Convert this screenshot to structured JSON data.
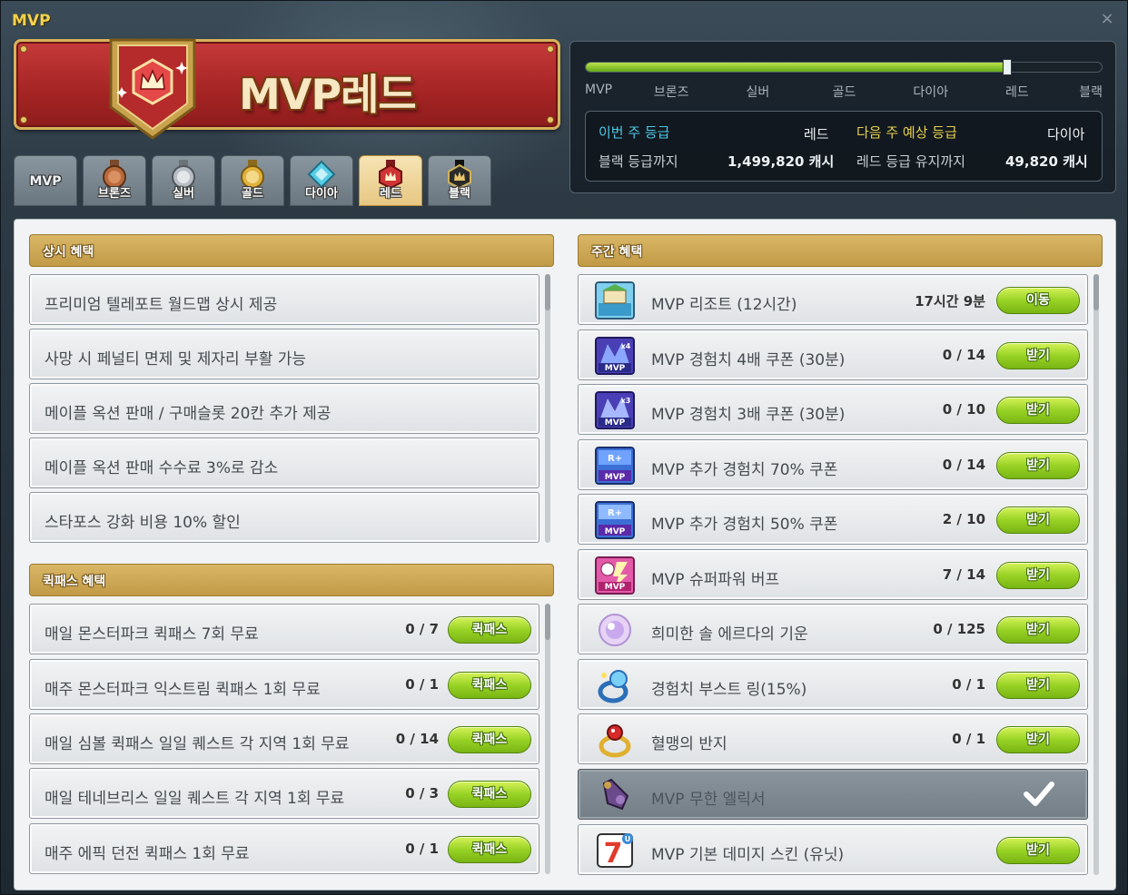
{
  "window": {
    "title": "MVP",
    "close_icon": "×"
  },
  "banner": {
    "text": "MVP레드",
    "medal_icon": "crown-medal-icon"
  },
  "tabs": [
    {
      "label": "MVP",
      "icon": "none",
      "active": false
    },
    {
      "label": "브론즈",
      "icon": "bronze-medal-icon",
      "active": false,
      "color": "#b86a3b"
    },
    {
      "label": "실버",
      "icon": "silver-medal-icon",
      "active": false,
      "color": "#b8bec4"
    },
    {
      "label": "골드",
      "icon": "gold-medal-icon",
      "active": false,
      "color": "#e0b23e"
    },
    {
      "label": "다이아",
      "icon": "diamond-medal-icon",
      "active": false,
      "color": "#57cde6"
    },
    {
      "label": "레드",
      "icon": "red-medal-icon",
      "active": true,
      "color": "#d03434"
    },
    {
      "label": "블랙",
      "icon": "black-medal-icon",
      "active": false,
      "color": "#2a2a2a"
    }
  ],
  "grade_progress": {
    "fill_fraction": 0.815,
    "labels": [
      "MVP",
      "브론즈",
      "실버",
      "골드",
      "다이아",
      "레드",
      "블랙"
    ]
  },
  "grade_info": {
    "this_week_label": "이번 주 등급",
    "this_week_value": "레드",
    "next_week_label": "다음 주 예상 등급",
    "next_week_value": "다이아",
    "to_black_label": "블랙 등급까지",
    "to_black_value": "1,499,820 캐시",
    "keep_red_label": "레드 등급 유지까지",
    "keep_red_value": "49,820 캐시"
  },
  "permanent": {
    "header": "상시 혜택",
    "items": [
      "프리미엄 텔레포트 월드맵 상시 제공",
      "사망 시 페널티 면제 및 제자리 부활 가능",
      "메이플 옥션 판매 / 구매슬롯 20칸 추가 제공",
      "메이플 옥션 판매 수수료 3%로 감소",
      "스타포스 강화 비용 10% 할인"
    ]
  },
  "quickpass": {
    "header": "퀵패스 혜택",
    "button_label": "퀵패스",
    "items": [
      {
        "label": "매일 몬스터파크 퀵패스 7회 무료",
        "count": "0 / 7"
      },
      {
        "label": "매주 몬스터파크 익스트림 퀵패스 1회 무료",
        "count": "0 / 1"
      },
      {
        "label": "매일 심볼 퀵패스 일일 퀘스트 각 지역 1회 무료",
        "count": "0 / 14"
      },
      {
        "label": "매일 테네브리스 일일 퀘스트 각 지역 1회 무료",
        "count": "0 / 3"
      },
      {
        "label": "매주 에픽 던전 퀵패스 1회 무료",
        "count": "0 / 1"
      }
    ]
  },
  "weekly": {
    "header": "주간 혜택",
    "items": [
      {
        "label": "MVP 리조트 (12시간)",
        "count": "17시간 9분",
        "button": "이동",
        "icon": "resort-icon",
        "done": false
      },
      {
        "label": "MVP 경험치 4배 쿠폰 (30분)",
        "count": "0 / 14",
        "button": "받기",
        "icon": "exp-coupon-x4-icon",
        "done": false
      },
      {
        "label": "MVP 경험치 3배 쿠폰 (30분)",
        "count": "0 / 10",
        "button": "받기",
        "icon": "exp-coupon-x3-icon",
        "done": false
      },
      {
        "label": "MVP 추가 경험치 70% 쿠폰",
        "count": "0 / 14",
        "button": "받기",
        "icon": "bonus-exp-coupon-icon",
        "done": false
      },
      {
        "label": "MVP 추가 경험치 50% 쿠폰",
        "count": "2 / 10",
        "button": "받기",
        "icon": "bonus-exp-coupon-icon",
        "done": false
      },
      {
        "label": "MVP 슈퍼파워 버프",
        "count": "7 / 14",
        "button": "받기",
        "icon": "superpower-buff-icon",
        "done": false
      },
      {
        "label": "희미한 솔 에르다의 기운",
        "count": "0 / 125",
        "button": "받기",
        "icon": "sol-erda-icon",
        "done": false
      },
      {
        "label": "경험치 부스트 링(15%)",
        "count": "0 / 1",
        "button": "받기",
        "icon": "exp-ring-icon",
        "done": false
      },
      {
        "label": "혈맹의 반지",
        "count": "0 / 1",
        "button": "받기",
        "icon": "ring-icon",
        "done": false
      },
      {
        "label": "MVP 무한 엘릭서",
        "count": "",
        "button": "",
        "icon": "elixir-icon",
        "done": true
      },
      {
        "label": "MVP 기본 데미지 스킨 (유닛)",
        "count": "",
        "button": "받기",
        "icon": "damage-skin-icon",
        "done": false
      }
    ]
  }
}
